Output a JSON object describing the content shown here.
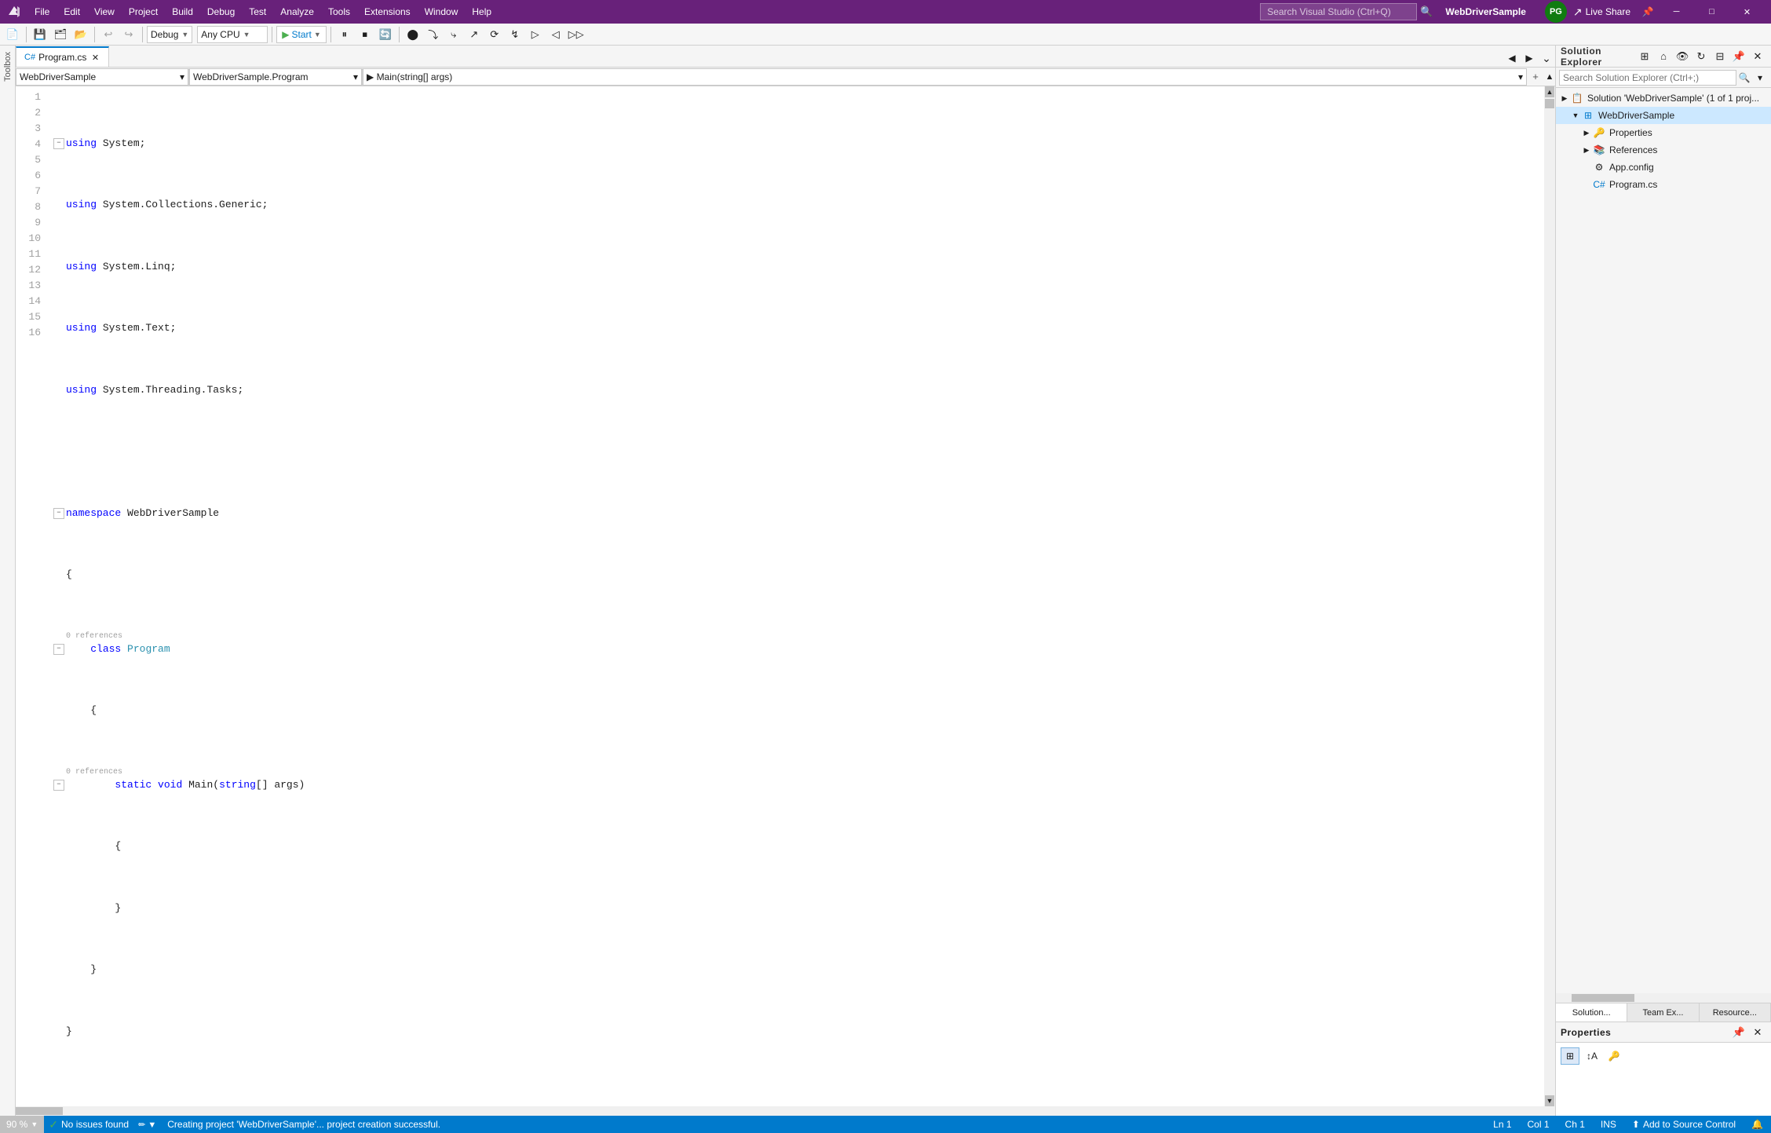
{
  "titlebar": {
    "menu_items": [
      "File",
      "Edit",
      "View",
      "Project",
      "Build",
      "Debug",
      "Test",
      "Analyze",
      "Tools",
      "Extensions",
      "Window",
      "Help"
    ],
    "search_placeholder": "Search Visual Studio (Ctrl+Q)",
    "window_title": "WebDriverSample",
    "live_share_label": "Live Share",
    "user_avatar": "PG",
    "user_avatar_bg": "#107c10",
    "minimize": "─",
    "maximize": "□",
    "close": "✕"
  },
  "toolbar": {
    "debug_label": "Debug",
    "cpu_label": "Any CPU",
    "start_label": "Start"
  },
  "editor": {
    "tab_label": "Program.cs",
    "nav_left": "WebDriverSample",
    "nav_mid": "WebDriverSample.Program",
    "nav_right": "▶ Main(string[] args)",
    "lines": [
      {
        "num": 1,
        "content": "using System;",
        "indent": 0,
        "collapse": true
      },
      {
        "num": 2,
        "content": "using System.Collections.Generic;",
        "indent": 0,
        "collapse": false
      },
      {
        "num": 3,
        "content": "using System.Linq;",
        "indent": 0,
        "collapse": false
      },
      {
        "num": 4,
        "content": "using System.Text;",
        "indent": 0,
        "collapse": false
      },
      {
        "num": 5,
        "content": "using System.Threading.Tasks;",
        "indent": 0,
        "collapse": false
      },
      {
        "num": 6,
        "content": "",
        "indent": 0,
        "collapse": false
      },
      {
        "num": 7,
        "content": "namespace WebDriverSample",
        "indent": 0,
        "collapse": true
      },
      {
        "num": 8,
        "content": "{",
        "indent": 0,
        "collapse": false,
        "ref": ""
      },
      {
        "num": 9,
        "content": "    class Program",
        "indent": 1,
        "collapse": true,
        "ref": "0 references"
      },
      {
        "num": 10,
        "content": "    {",
        "indent": 1,
        "collapse": false
      },
      {
        "num": 11,
        "content": "        static void Main(string[] args)",
        "indent": 2,
        "collapse": true,
        "ref": "0 references"
      },
      {
        "num": 12,
        "content": "        {",
        "indent": 2,
        "collapse": false
      },
      {
        "num": 13,
        "content": "        }",
        "indent": 2,
        "collapse": false
      },
      {
        "num": 14,
        "content": "    }",
        "indent": 1,
        "collapse": false
      },
      {
        "num": 15,
        "content": "}",
        "indent": 0,
        "collapse": false
      },
      {
        "num": 16,
        "content": "",
        "indent": 0,
        "collapse": false
      }
    ]
  },
  "solution_explorer": {
    "title": "Solution Explorer",
    "search_placeholder": "Search Solution Explorer (Ctrl+;)",
    "tree": [
      {
        "label": "Solution 'WebDriverSample' (1 of",
        "icon": "solution",
        "level": 0,
        "expanded": true
      },
      {
        "label": "WebDriverSample",
        "icon": "project",
        "level": 1,
        "expanded": true,
        "selected": true
      },
      {
        "label": "Properties",
        "icon": "properties",
        "level": 2,
        "expanded": false
      },
      {
        "label": "References",
        "icon": "references",
        "level": 2,
        "expanded": false
      },
      {
        "label": "App.config",
        "icon": "config",
        "level": 2,
        "expanded": false
      },
      {
        "label": "Program.cs",
        "icon": "cs",
        "level": 2,
        "expanded": false
      }
    ],
    "tabs": [
      "Solution...",
      "Team Ex...",
      "Resource..."
    ]
  },
  "properties": {
    "title": "Properties"
  },
  "statusbar": {
    "message": "Creating project 'WebDriverSample'... project creation successful.",
    "ln": "Ln 1",
    "col": "Col 1",
    "ch": "Ch 1",
    "ins": "INS",
    "zoom": "90 %",
    "issues": "No issues found",
    "source_control": "Add to Source Control"
  },
  "toolbox": {
    "label": "Toolbox"
  }
}
